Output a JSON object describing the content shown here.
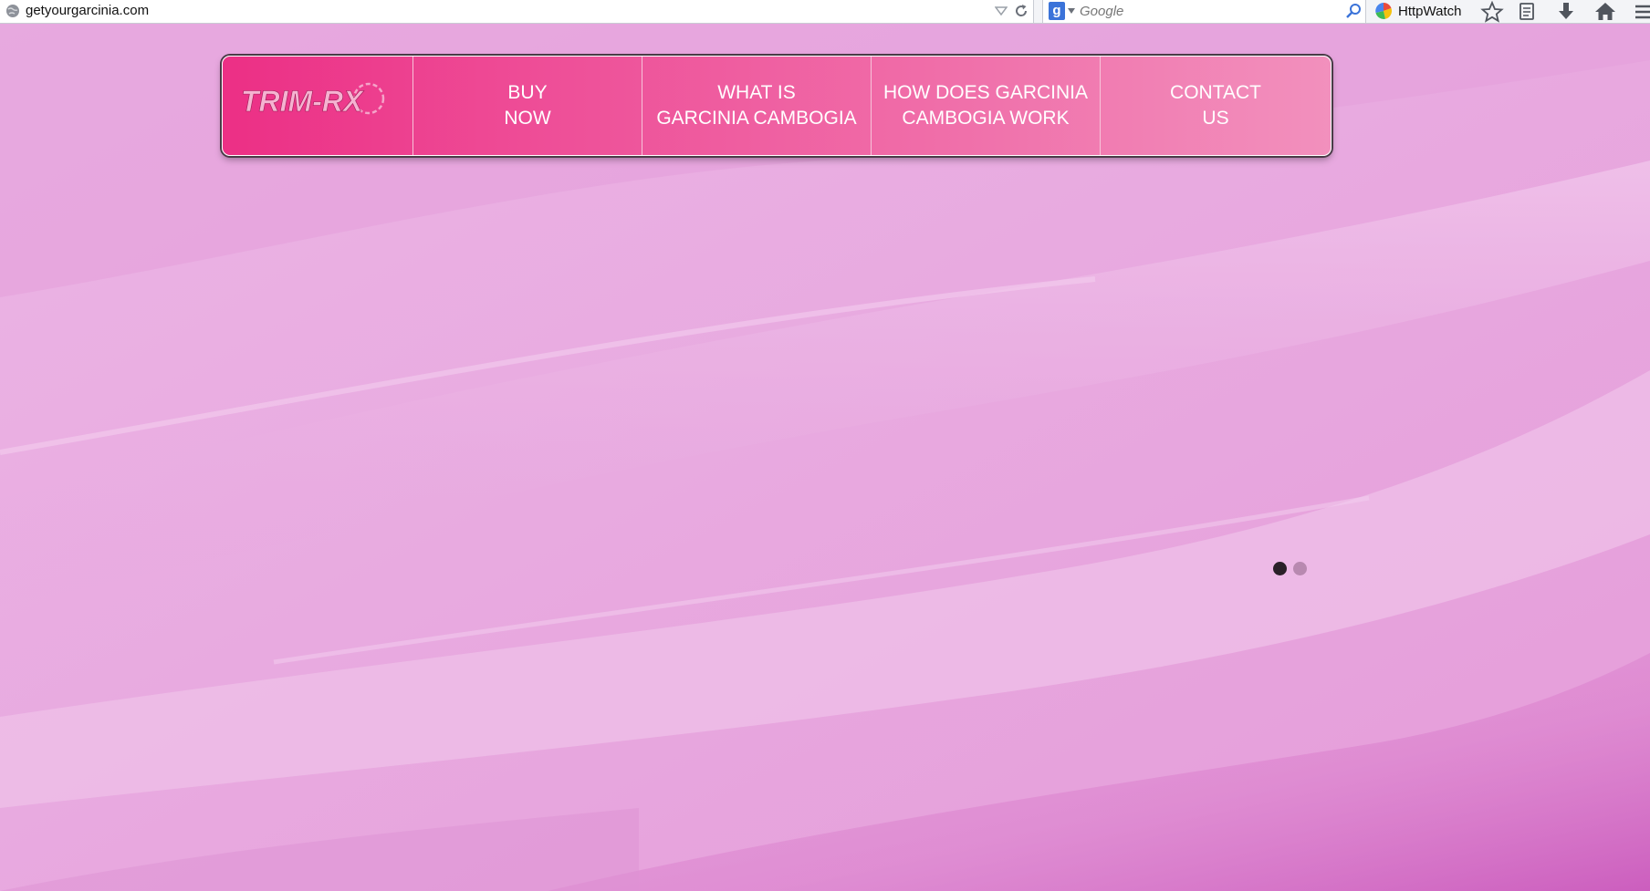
{
  "browser": {
    "url": "getyourgarcinia.com",
    "search_engine_icon": "g-search-icon",
    "search_placeholder": "Google",
    "extension_label": "HttpWatch",
    "toolbar_icons": [
      "bookmark-star-icon",
      "reading-list-icon",
      "downloads-icon",
      "home-icon",
      "menu-icon"
    ]
  },
  "nav": {
    "logo_text": "TRIM-RX",
    "items": [
      {
        "line1": "BUY",
        "line2": "NOW"
      },
      {
        "line1": "WHAT IS",
        "line2": "GARCINIA CAMBOGIA"
      },
      {
        "line1": "HOW DOES GARCINIA",
        "line2": "CAMBOGIA WORK"
      },
      {
        "line1": "CONTACT",
        "line2": "US"
      }
    ]
  },
  "slider": {
    "active_dot_color": "#2a1f28",
    "inactive_dot_color": "#b889b0",
    "dots": 2,
    "active_index": 0
  },
  "colors": {
    "nav_start": "#ec2f85",
    "nav_end": "#f290bd",
    "background": "#e6a6df"
  }
}
